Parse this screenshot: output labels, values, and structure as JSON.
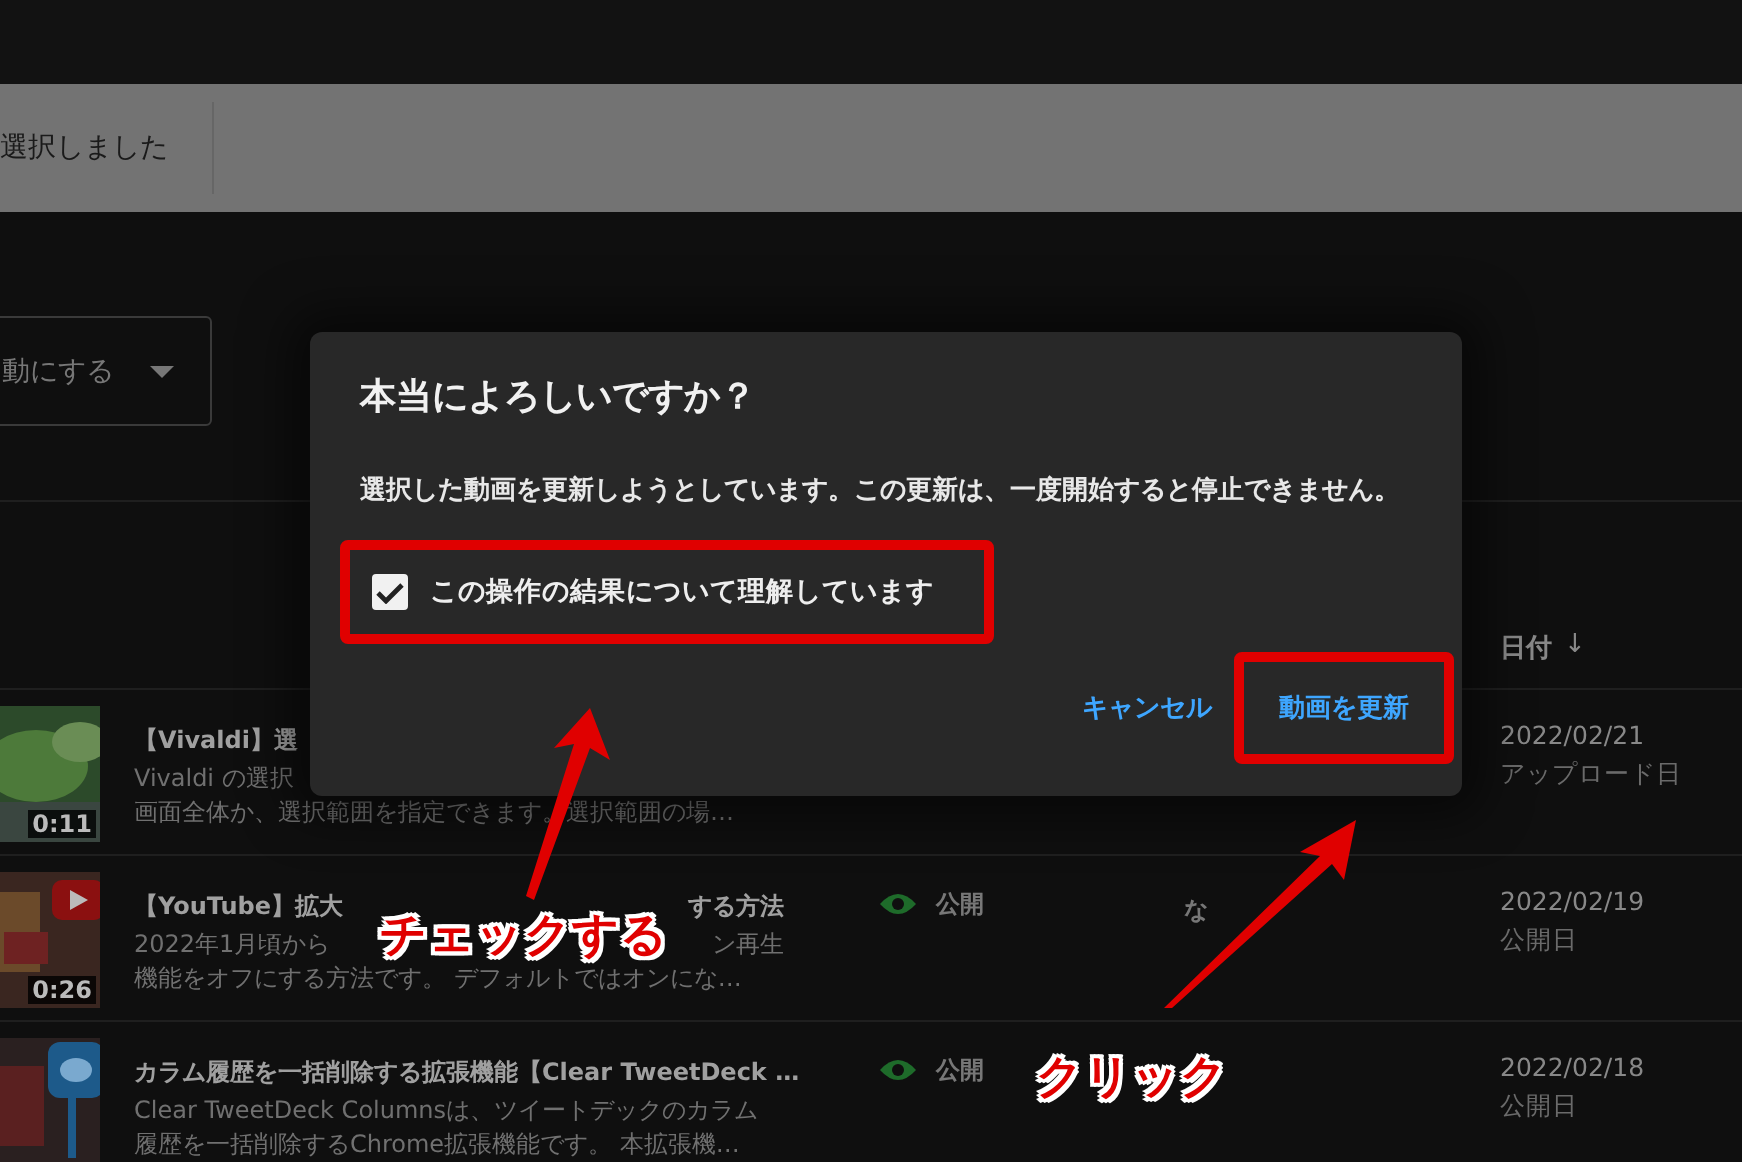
{
  "selection_bar": {
    "text": "選択しました"
  },
  "toolbar": {
    "dropdown": {
      "value": "動にする"
    }
  },
  "table": {
    "header": {
      "label": "日付",
      "sort_arrow": "↓"
    },
    "rows": [
      {
        "title": [
          "【Vivaldi】選"
        ],
        "description": [
          [
            "Vivaldi の選択"
          ],
          [
            "画面全体か、選択範囲を指定できます。選択範囲の場…"
          ]
        ],
        "duration": "0:11",
        "date": "2022/02/21",
        "date_label": "アップロード日"
      },
      {
        "title": [
          "【YouTube】拡大",
          "する方法"
        ],
        "description": [
          [
            "2022年1月頃から",
            "ン再生"
          ],
          [
            "機能をオフにする方法です。 デフォルトではオンにな…"
          ]
        ],
        "duration": "0:26",
        "visibility": "公開",
        "column_4": "な",
        "date": "2022/02/19",
        "date_label": "公開日"
      },
      {
        "title": [
          "カラム履歴を一括削除する拡張機能【Clear TweetDeck …"
        ],
        "description": [
          [
            "Clear TweetDeck Columnsは、ツイートデックのカラム"
          ],
          [
            "履歴を一括削除するChrome拡張機能です。 本拡張機…"
          ]
        ],
        "visibility": "公開",
        "date": "2022/02/18",
        "date_label": "公開日"
      }
    ]
  },
  "dialog": {
    "title": "本当によろしいですか？",
    "message": "選択した動画を更新しようとしています。この更新は、一度開始すると停止できません。",
    "checkbox": {
      "label": "この操作の結果について理解しています",
      "checked": true,
      "highlighted": true
    },
    "buttons": [
      {
        "label": "キャンセル",
        "highlighted": false
      },
      {
        "label": "動画を更新",
        "highlighted": true
      }
    ]
  },
  "annotations": [
    {
      "text": "チェックする"
    },
    {
      "text": "クリック"
    }
  ]
}
